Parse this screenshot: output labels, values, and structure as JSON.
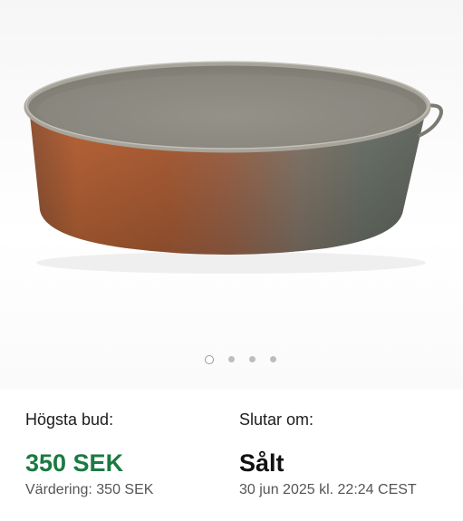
{
  "gallery": {
    "image_alt": "Copper and tin cake pan",
    "dot_count": 4,
    "active_dot": 1
  },
  "bid": {
    "label": "Högsta bud:",
    "amount": "350 SEK",
    "valuation": "Värdering: 350 SEK"
  },
  "end": {
    "label": "Slutar om:",
    "status": "Sålt",
    "datetime": "30 jun 2025 kl. 22:24 CEST"
  },
  "colors": {
    "price": "#1b7a42",
    "dot_inactive": "#bdbdbd",
    "dot_active_border": "#9a9a9a"
  }
}
